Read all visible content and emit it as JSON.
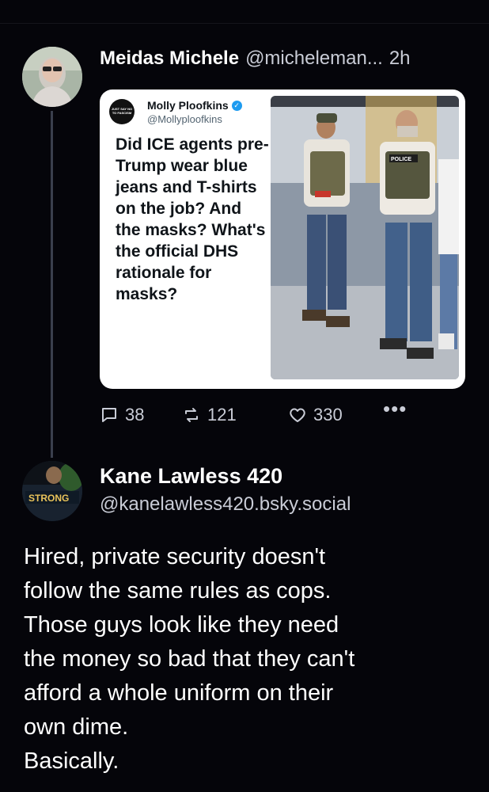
{
  "post1": {
    "author_name": "Meidas Michele",
    "author_handle": "@micheleman...",
    "time": "2h",
    "quote": {
      "author_name": "Molly Ploofkins",
      "author_handle": "@Mollyploofkins",
      "avatar_text": "JUST SAY NO TO FASCISM",
      "text": "Did ICE agents pre-Trump wear blue jeans and T-shirts on the job? And the masks? What's the official DHS rationale for masks?",
      "image_label": "POLICE"
    },
    "actions": {
      "replies": "38",
      "reposts": "121",
      "likes": "330",
      "more": "•••"
    }
  },
  "post2": {
    "author_name": "Kane Lawless 420",
    "author_handle": "@kanelawless420.bsky.social",
    "avatar_text": "STRONG",
    "lines": [
      "Hired, private security doesn't",
      "follow the same rules as cops.",
      "Those guys look like they need",
      "the money so bad that they can't",
      "afford a whole uniform on their",
      "own dime.",
      "Basically."
    ]
  },
  "colors": {
    "background": "#05050a",
    "text_primary": "#ffffff",
    "text_secondary": "#c9ccd6",
    "thread_line": "#3a3f4d",
    "verified_badge": "#1d9bf0"
  }
}
